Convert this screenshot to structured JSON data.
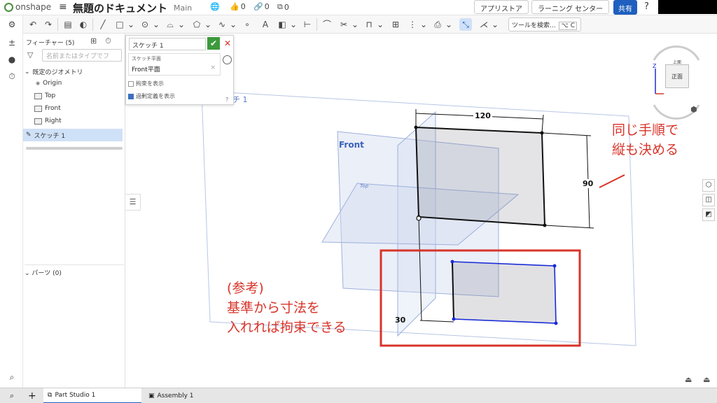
{
  "header": {
    "logo_text": "onshape",
    "doc_title": "無題のドキュメント",
    "branch": "Main",
    "likes": "0",
    "links": "0",
    "copies": "0",
    "app_store": "アプリストア",
    "learning_center": "ラーニング センター",
    "share": "共有"
  },
  "toolbar": {
    "search_label": "ツールを検索...",
    "search_shortcut": "⌥ C"
  },
  "feature_panel": {
    "header": "フィーチャー (5)",
    "search_placeholder": "名前またはタイプでフ",
    "default_geometry": "既定のジオメトリ",
    "items": [
      "Origin",
      "Top",
      "Front",
      "Right"
    ],
    "sketch": "スケッチ 1",
    "parts": "パーツ (0)"
  },
  "dialog": {
    "title": "スケッチ 1",
    "plane_label": "スケッチ平面",
    "plane_value": "Front平面",
    "show_constraints": "拘束を表示",
    "show_overdefined": "過剰定義を表示"
  },
  "viewport": {
    "sketch_tag": "チ 1",
    "front_label": "Front",
    "top_label": "Top",
    "dim_width": "120",
    "dim_height": "90",
    "dim_offset": "30",
    "annotation_right": [
      "同じ手順で",
      "縦も決める"
    ],
    "annotation_bottom": [
      "(参考)",
      "基準から寸法を",
      "入れれば拘束できる"
    ],
    "annotation_color": "#d8342a"
  },
  "viewcube": {
    "face": "正面",
    "top": "上面",
    "axis_z": "Z"
  },
  "bottom_tabs": {
    "part_studio": "Part Studio 1",
    "assembly": "Assembly 1"
  }
}
